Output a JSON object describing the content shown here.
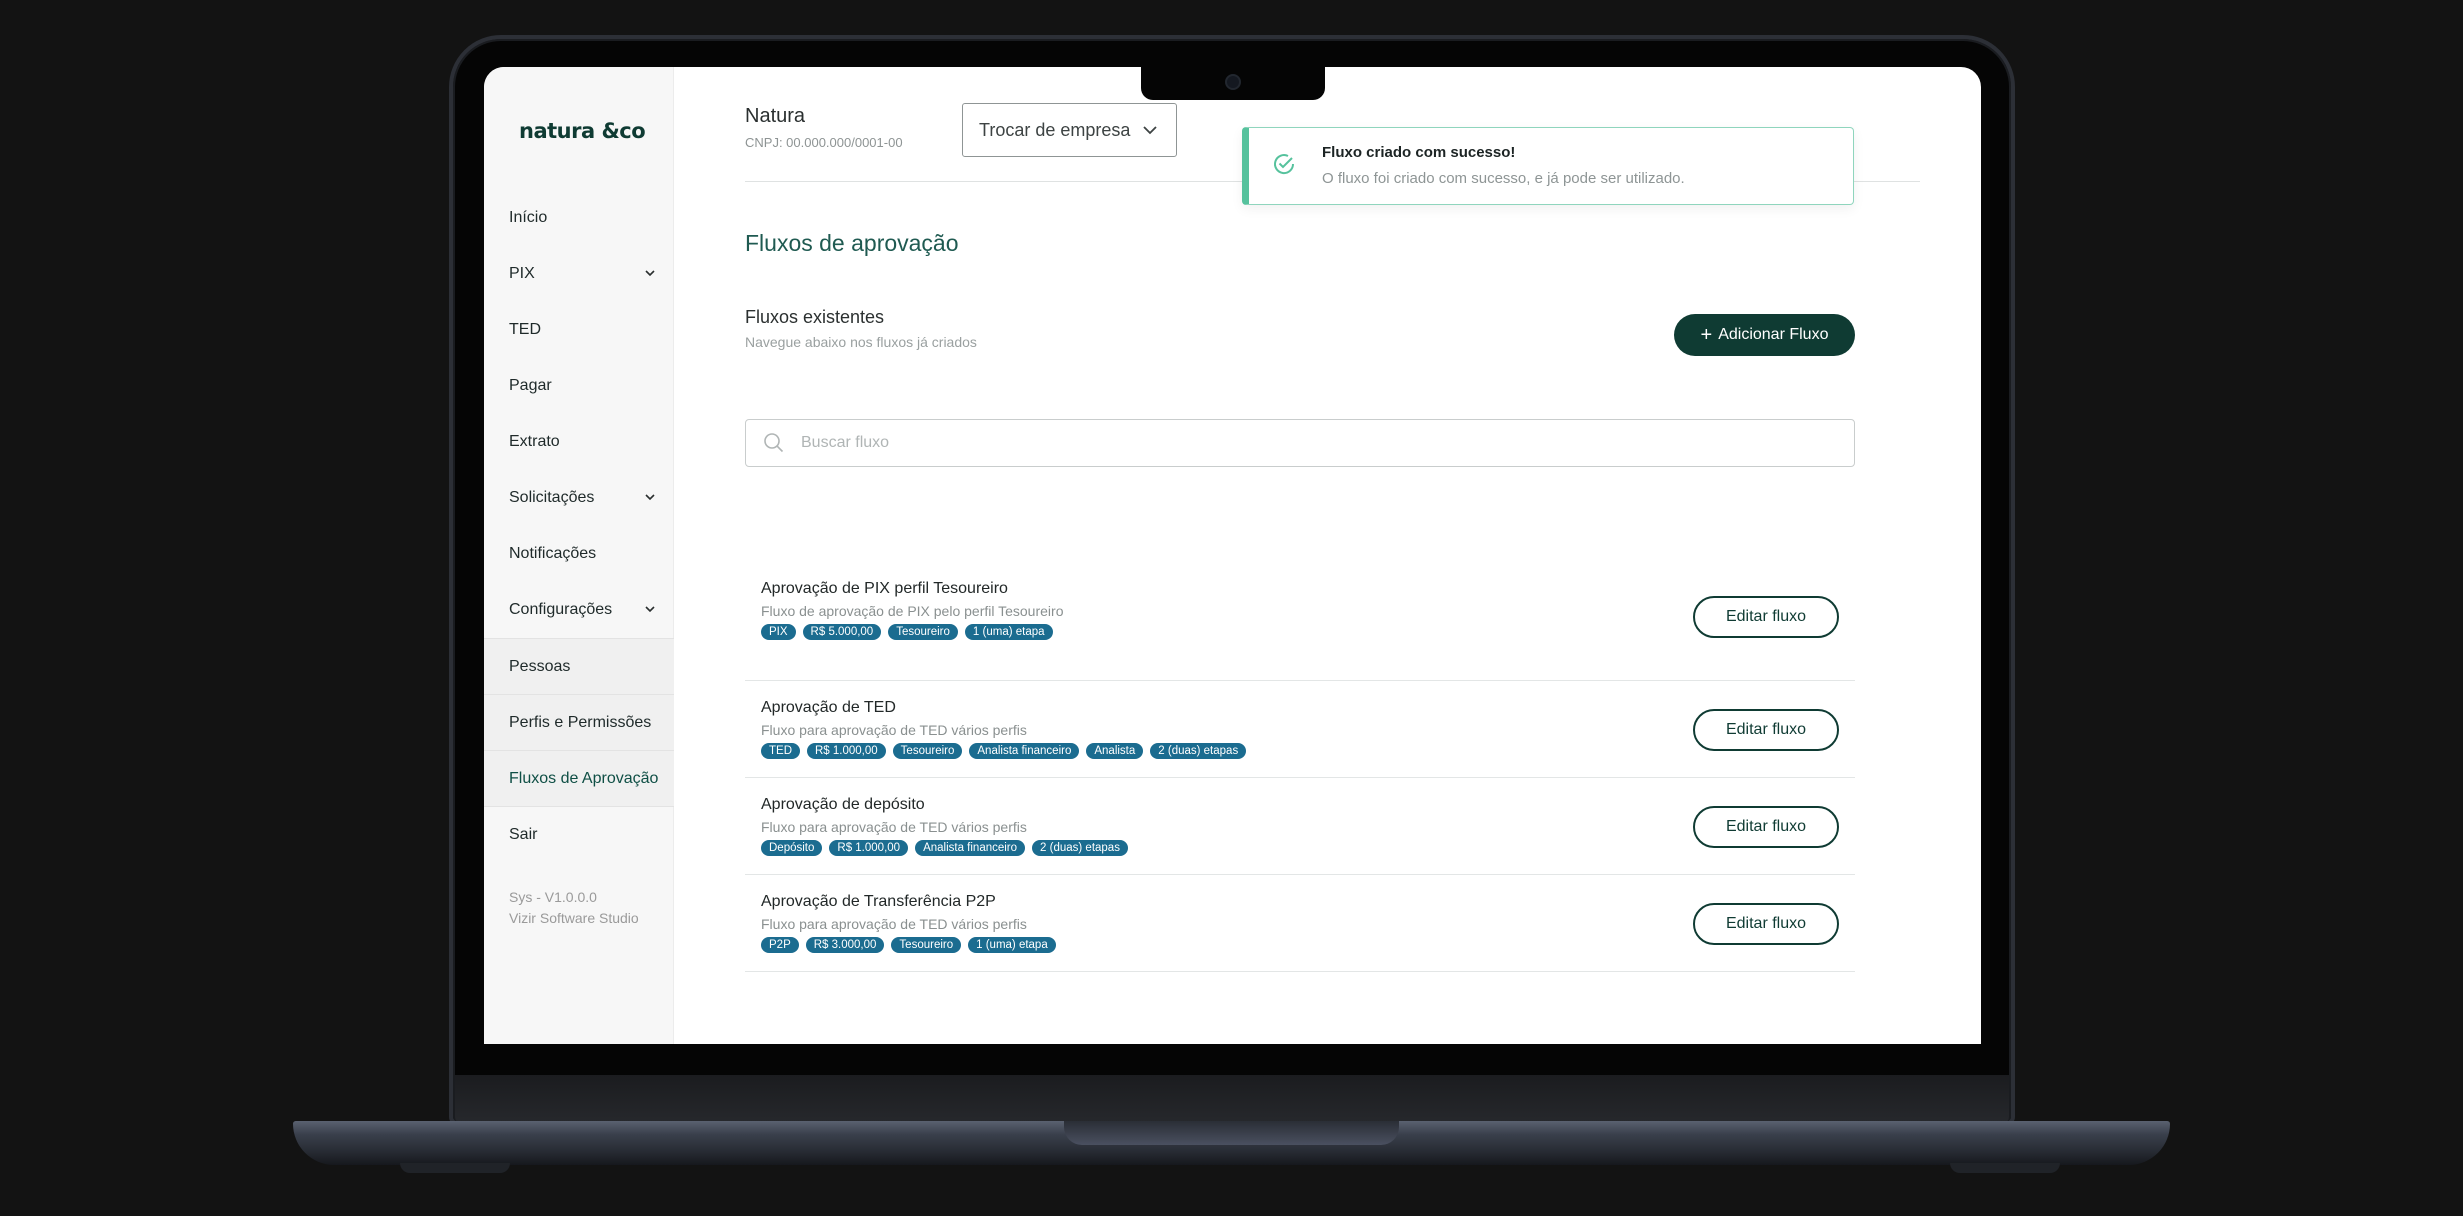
{
  "sidebar": {
    "logo": "natura &co",
    "items": [
      {
        "label": "Início",
        "chevron": false
      },
      {
        "label": "PIX",
        "chevron": true
      },
      {
        "label": "TED",
        "chevron": false
      },
      {
        "label": "Pagar",
        "chevron": false
      },
      {
        "label": "Extrato",
        "chevron": false
      },
      {
        "label": "Solicitações",
        "chevron": true
      },
      {
        "label": "Notificações",
        "chevron": false
      },
      {
        "label": "Configurações",
        "chevron": true
      },
      {
        "label": "Pessoas",
        "chevron": false
      },
      {
        "label": "Perfis e Permissões",
        "chevron": false
      },
      {
        "label": "Fluxos de Aprovação",
        "chevron": false
      },
      {
        "label": "Sair",
        "chevron": false
      }
    ],
    "version_line1": "Sys - V1.0.0.0",
    "version_line2": "Vizir Software Studio"
  },
  "header": {
    "company_name": "Natura",
    "cnpj": "CNPJ: 00.000.000/0001-00",
    "switch_company": "Trocar de empresa"
  },
  "toast": {
    "title": "Fluxo criado com sucesso!",
    "message": "O fluxo foi criado com sucesso, e já pode ser utilizado."
  },
  "main": {
    "page_title": "Fluxos de aprovação",
    "section_title": "Fluxos existentes",
    "section_subtitle": "Navegue abaixo nos fluxos já criados",
    "add_button": "Adicionar Fluxo",
    "add_plus": "+",
    "search_placeholder": "Buscar fluxo",
    "edit_label": "Editar fluxo",
    "flows": [
      {
        "title": "Aprovação de PIX perfil Tesoureiro",
        "desc": "Fluxo de aprovação de PIX pelo perfil Tesoureiro",
        "tags": [
          "PIX",
          "R$ 5.000,00",
          "Tesoureiro",
          "1 (uma) etapa"
        ]
      },
      {
        "title": "Aprovação de TED",
        "desc": "Fluxo para aprovação de TED vários perfis",
        "tags": [
          "TED",
          "R$ 1.000,00",
          "Tesoureiro",
          "Analista financeiro",
          "Analista",
          "2 (duas) etapas"
        ]
      },
      {
        "title": "Aprovação de depósito",
        "desc": "Fluxo para aprovação de TED vários perfis",
        "tags": [
          "Depósito",
          "R$ 1.000,00",
          "Analista financeiro",
          "2 (duas) etapas"
        ]
      },
      {
        "title": "Aprovação de Transferência P2P",
        "desc": "Fluxo para aprovação de TED vários perfis",
        "tags": [
          "P2P",
          "R$ 3.000,00",
          "Tesoureiro",
          "1 (uma) etapa"
        ]
      }
    ]
  },
  "colors": {
    "brand_dark": "#0f3b33",
    "tag_blue": "#1b6c90",
    "success_green": "#56c29d"
  }
}
